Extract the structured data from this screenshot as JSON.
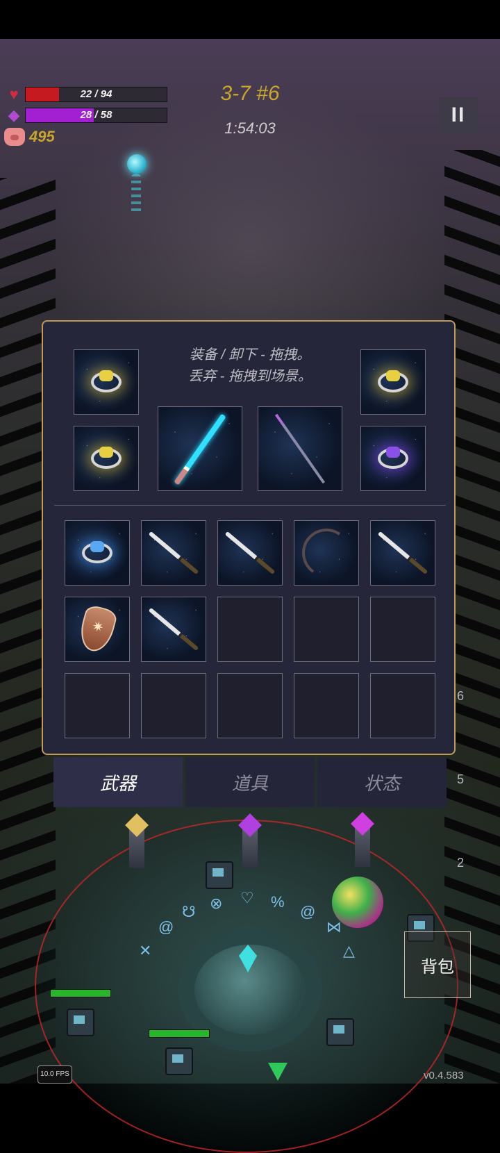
{
  "hud": {
    "hp": {
      "text": "22 / 94",
      "current": 22,
      "max": 94
    },
    "mp": {
      "text": "28 / 58",
      "current": 28,
      "max": 58
    },
    "coins": "495",
    "stage": "3-7 #6",
    "timer": "1:54:03",
    "pause_label": "II"
  },
  "inventory": {
    "hint_line1": "装备 / 卸下 - 拖拽。",
    "hint_line2": "丢弃 - 拖拽到场景。",
    "equipped": [
      {
        "slot": "ring-top-left",
        "item": "gold-ring-icon"
      },
      {
        "slot": "ring-bottom-left",
        "item": "gold-ring-icon"
      },
      {
        "slot": "weapon-1",
        "item": "crystal-sword-icon"
      },
      {
        "slot": "weapon-2",
        "item": "magic-staff-icon"
      },
      {
        "slot": "ring-top-right",
        "item": "gold-ring-icon"
      },
      {
        "slot": "ring-bottom-right",
        "item": "purple-ring-icon"
      }
    ],
    "bag": [
      "blue-ring-icon",
      "katana-icon",
      "katana-icon",
      "bow-icon",
      "katana-icon",
      "winged-shield-icon",
      "katana-icon",
      "",
      "",
      "",
      "",
      "",
      "",
      "",
      ""
    ]
  },
  "tabs": [
    {
      "label": "武器",
      "active": true
    },
    {
      "label": "道具",
      "active": false
    },
    {
      "label": "状态",
      "active": false
    }
  ],
  "bottom": {
    "bag_button": "背包",
    "fps": "10.0 FPS",
    "version": "v0.4.583",
    "side_numbers": [
      "6",
      "5",
      "2"
    ]
  },
  "colors": {
    "panel_bg": "#26263a",
    "panel_border": "#bf9b58",
    "gold_text": "#c9a52b",
    "hp_red": "#c51a1f",
    "mp_purple": "#a21fd2"
  }
}
